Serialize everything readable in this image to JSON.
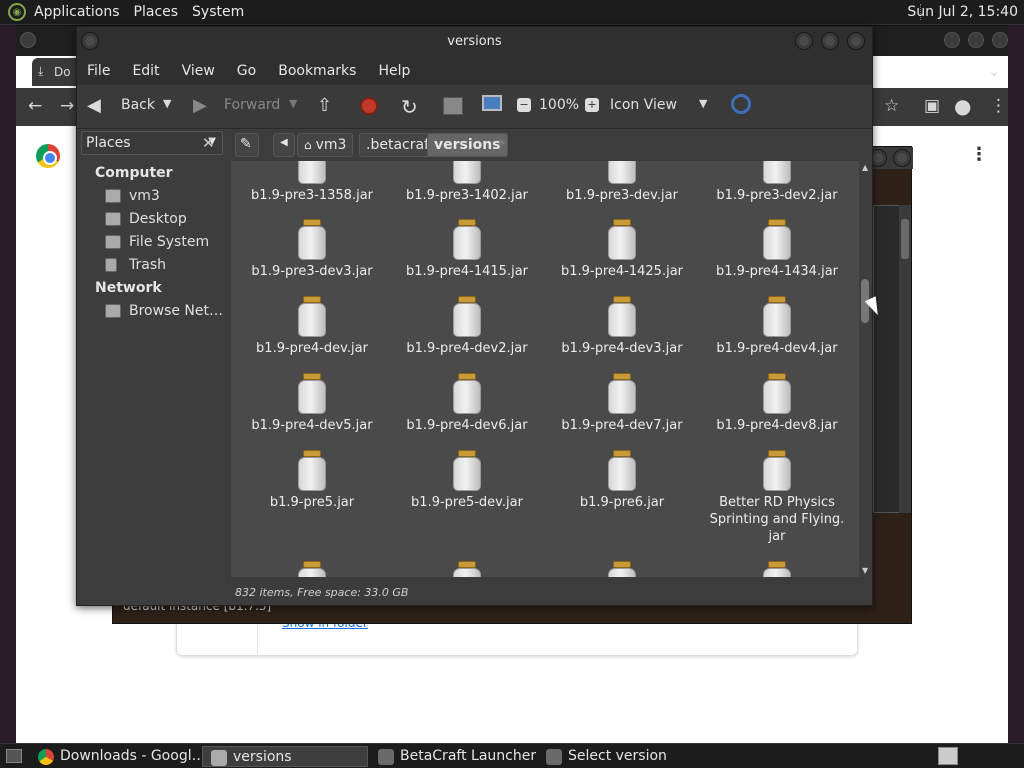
{
  "top_panel": {
    "menus": [
      "Applications",
      "Places",
      "System"
    ],
    "clock": "Sun Jul  2, 15:40"
  },
  "chrome": {
    "tab_label": "Do",
    "show_in_folder": "Show in folder"
  },
  "betacraft": {
    "instance_label": "default instance [b1.7.3]"
  },
  "window": {
    "title": "versions",
    "menu": [
      "File",
      "Edit",
      "View",
      "Go",
      "Bookmarks",
      "Help"
    ],
    "toolbar": {
      "back": "Back",
      "forward": "Forward",
      "zoom": "100%",
      "view_mode": "Icon View"
    },
    "sidebar": {
      "header": "Places",
      "sections": [
        {
          "title": "Computer",
          "items": [
            "vm3",
            "Desktop",
            "File System",
            "Trash"
          ]
        },
        {
          "title": "Network",
          "items": [
            "Browse Net…"
          ]
        }
      ]
    },
    "path": [
      "vm3",
      ".betacraft",
      "versions"
    ],
    "files": [
      "b1.9-pre3-1358.jar",
      "b1.9-pre3-1402.jar",
      "b1.9-pre3-dev.jar",
      "b1.9-pre3-dev2.jar",
      "b1.9-pre3-dev3.jar",
      "b1.9-pre4-1415.jar",
      "b1.9-pre4-1425.jar",
      "b1.9-pre4-1434.jar",
      "b1.9-pre4-dev.jar",
      "b1.9-pre4-dev2.jar",
      "b1.9-pre4-dev3.jar",
      "b1.9-pre4-dev4.jar",
      "b1.9-pre4-dev5.jar",
      "b1.9-pre4-dev6.jar",
      "b1.9-pre4-dev7.jar",
      "b1.9-pre4-dev8.jar",
      "b1.9-pre5.jar",
      "b1.9-pre5-dev.jar",
      "b1.9-pre6.jar",
      "Better RD Physics Sprinting and Flying. jar"
    ],
    "status": "832 items, Free space: 33.0 GB"
  },
  "taskbar": {
    "tasks": [
      "Downloads - Googl…",
      "versions",
      "BetaCraft Launcher …",
      "Select version"
    ]
  },
  "colors": {
    "panel_bg": "#1c1c1c",
    "window_bg": "#3c3c3c",
    "content_bg": "#4a4a4a",
    "jar_lid": "#c89a3a"
  }
}
